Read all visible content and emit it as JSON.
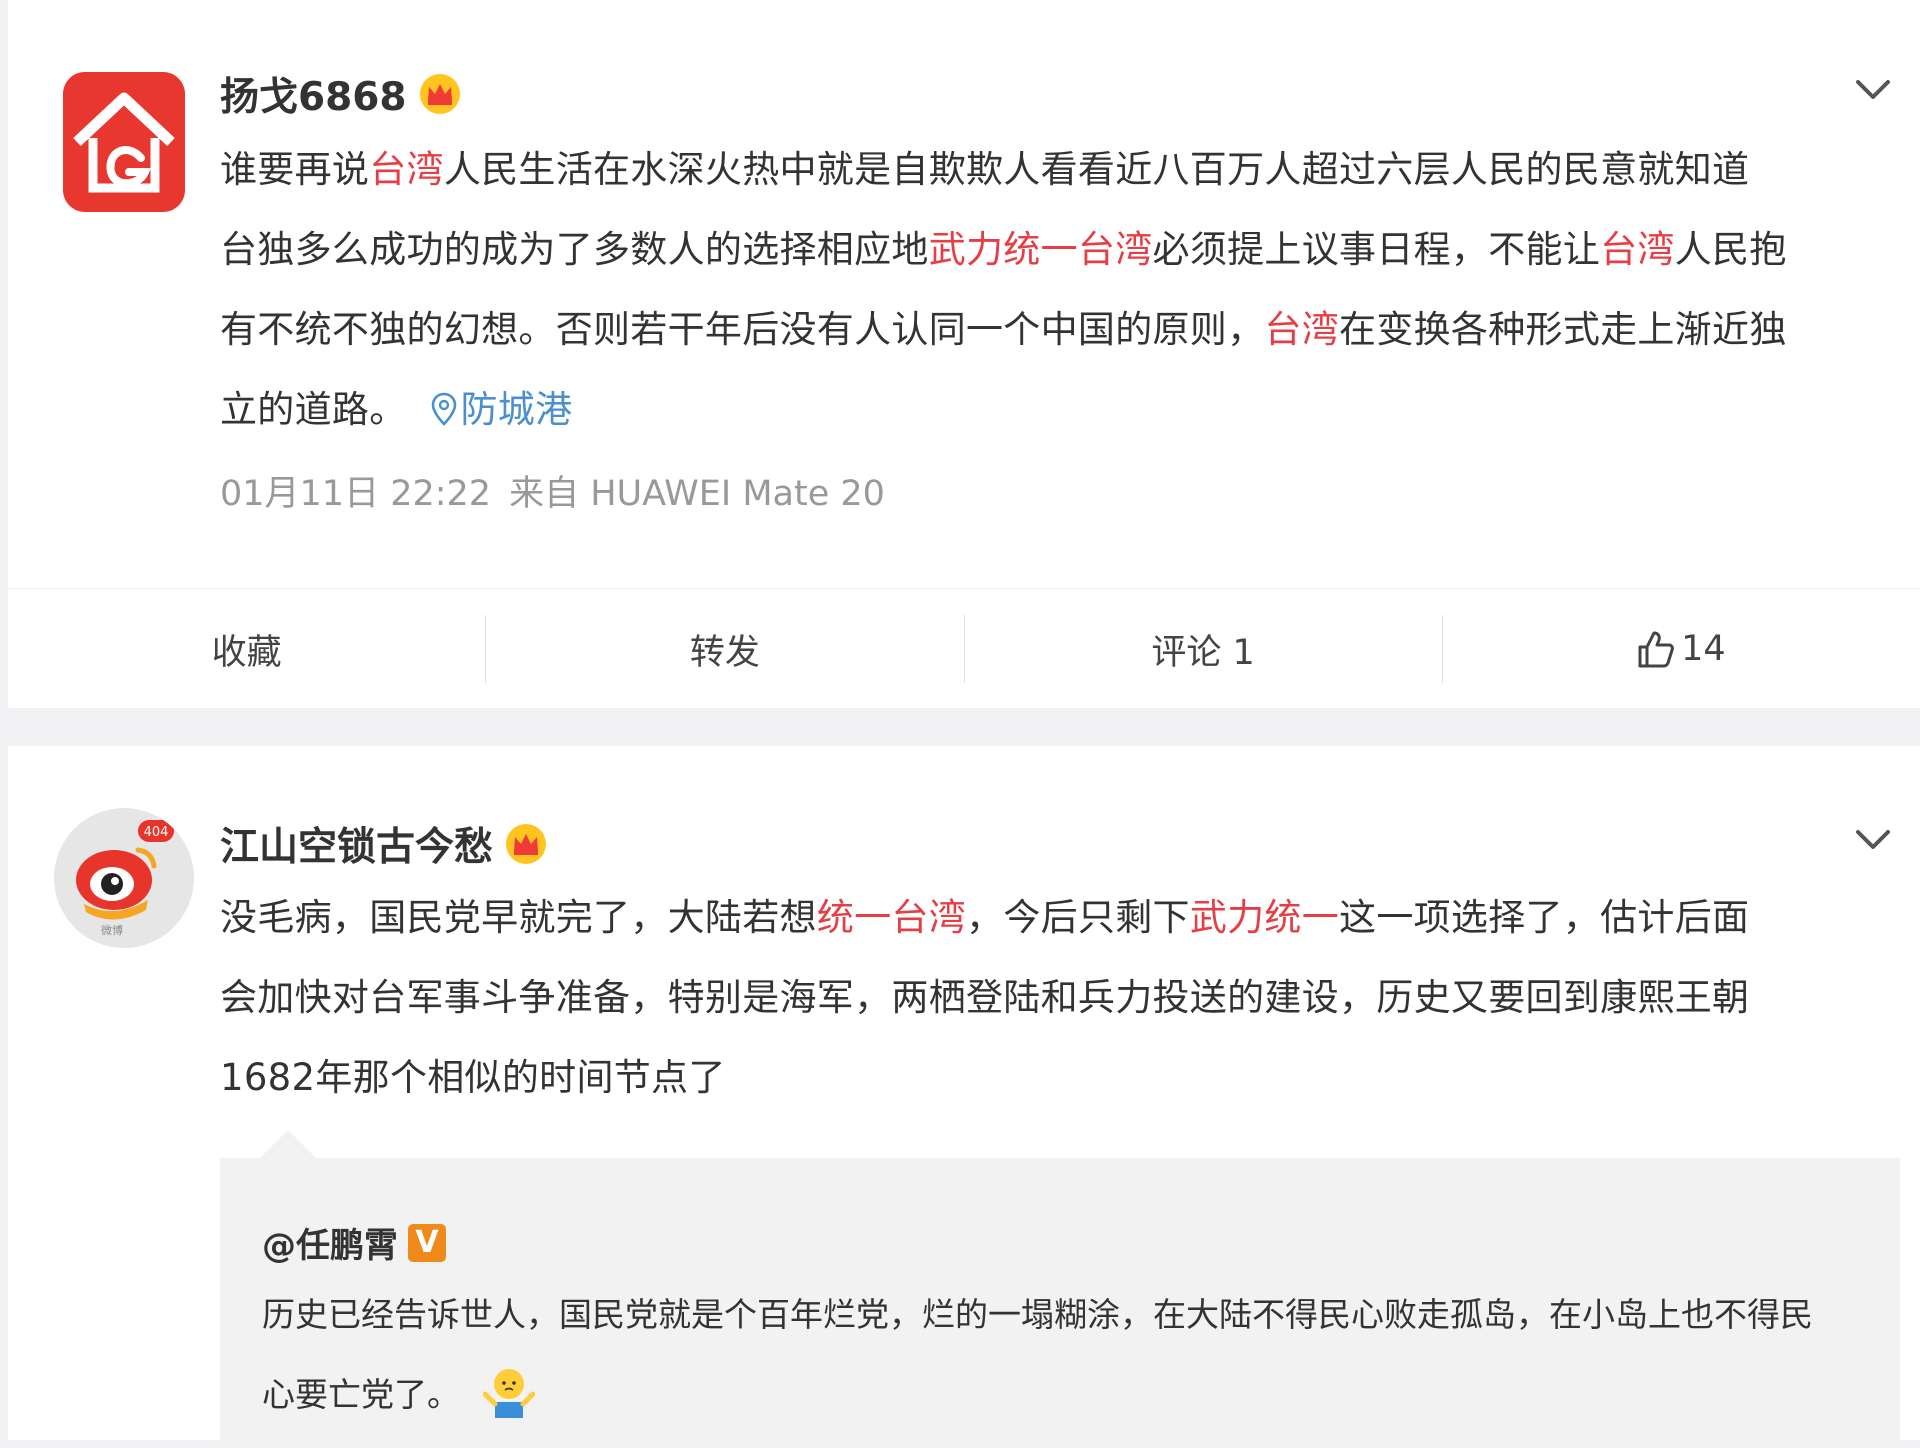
{
  "posts": [
    {
      "username": "扬戈6868",
      "text_lines": [
        [
          {
            "t": "谁要再说"
          },
          {
            "t": "台湾",
            "hl": true
          },
          {
            "t": "人民生活在水深火热中就是自欺欺人看看近八百万人超过六层人民的民意就知道"
          }
        ],
        [
          {
            "t": "台独多么成功的成为了多数人的选择相应地"
          },
          {
            "t": "武力统一台湾",
            "hl": true
          },
          {
            "t": "必须提上议事日程，不能让"
          },
          {
            "t": "台湾",
            "hl": true
          },
          {
            "t": "人民抱"
          }
        ],
        [
          {
            "t": "有不统不独的幻想。否则若干年后没有人认同一个中国的原则，"
          },
          {
            "t": "台湾",
            "hl": true
          },
          {
            "t": "在变换各种形式走上渐近独"
          }
        ],
        [
          {
            "t": "立的道路。"
          }
        ]
      ],
      "location": "防城港",
      "time": "01月11日 22:22",
      "source": "来自 HUAWEI Mate 20",
      "actions": {
        "favorite": "收藏",
        "repost": "转发",
        "comment": "评论 1",
        "like_count": "14"
      }
    },
    {
      "username": "江山空锁古今愁",
      "avatar_badge": "404",
      "avatar_caption": "微博",
      "text_lines": [
        [
          {
            "t": "没毛病，国民党早就完了，大陆若想"
          },
          {
            "t": "统一台湾",
            "hl": true
          },
          {
            "t": "，今后只剩下"
          },
          {
            "t": "武力统一",
            "hl": true
          },
          {
            "t": "这一项选择了，估计后面"
          }
        ],
        [
          {
            "t": "会加快对台军事斗争准备，特别是海军，两栖登陆和兵力投送的建设，历史又要回到康熙王朝"
          }
        ],
        [
          {
            "t": "1682年那个相似的时间节点了"
          }
        ]
      ],
      "repost": {
        "username": "@任鹏霄",
        "verified_badge": "V",
        "text_lines": [
          "历史已经告诉世人，国民党就是个百年烂党，烂的一塌糊涂，在大陆不得民心败走孤岛，在小岛上也不得民",
          "心要亡党了。"
        ],
        "emoji": "shrug-emoji"
      }
    }
  ],
  "colors": {
    "highlight": "#e63e45",
    "link": "#4b8fcf",
    "verified": "#f08a1b",
    "page_bg": "#f2f2f5"
  },
  "icons": [
    "crown-icon",
    "chevron-down-icon",
    "location-pin-icon",
    "thumbs-up-icon",
    "shrug-emoji"
  ]
}
